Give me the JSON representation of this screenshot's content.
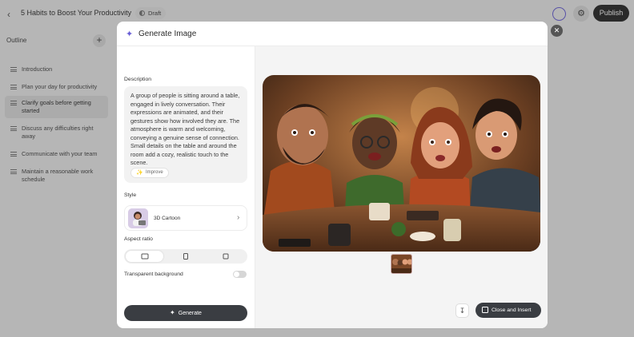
{
  "topbar": {
    "back_icon": "chevron-left-icon",
    "doc_title": "5 Habits to Boost Your Productivity",
    "status_badge": "Draft",
    "publish_label": "Publish"
  },
  "outline": {
    "heading": "Outline",
    "items": [
      {
        "label": "Introduction"
      },
      {
        "label": "Plan your day for productivity"
      },
      {
        "label": "Clarify goals before getting started"
      },
      {
        "label": "Discuss any difficulties right away"
      },
      {
        "label": "Communicate with your team"
      },
      {
        "label": "Maintain a reasonable work schedule"
      }
    ],
    "active_index": 2
  },
  "modal": {
    "title": "Generate Image",
    "description_label": "Description",
    "description_text": "A group of people is sitting around a table, engaged in lively conversation. Their expressions are animated, and their gestures show how involved they are. The atmosphere is warm and welcoming, conveying a genuine sense of connection. Small details on the table and around the room add a cozy, realistic touch to the scene.",
    "improve_label": "Improve",
    "style_label": "Style",
    "style_value": "3D Cartoon",
    "aspect_ratio_label": "Aspect ratio",
    "aspect_ratio_options": [
      "landscape",
      "portrait",
      "square"
    ],
    "aspect_ratio_selected": "landscape",
    "transparent_label": "Transparent background",
    "transparent_enabled": false,
    "generate_label": "Generate",
    "close_insert_label": "Close and Insert"
  },
  "colors": {
    "accent": "#6a5fd6",
    "dark_button": "#3a3d42"
  }
}
